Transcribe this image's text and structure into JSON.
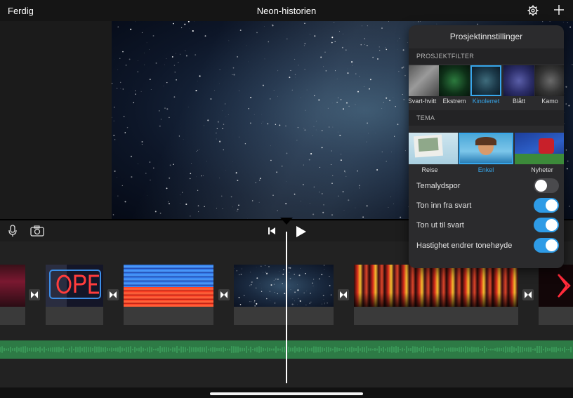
{
  "topbar": {
    "done_label": "Ferdig",
    "title": "Neon-historien",
    "icons": [
      "gear-icon",
      "plus-icon"
    ]
  },
  "controls": {
    "icons": [
      "microphone-icon",
      "camera-icon",
      "skip-to-start-icon",
      "play-icon"
    ]
  },
  "popover": {
    "title": "Prosjektinnstillinger",
    "filter_header": "PROSJEKTFILTER",
    "filters": [
      {
        "label": "Svart-hvitt",
        "selected": false
      },
      {
        "label": "Ekstrem",
        "selected": false
      },
      {
        "label": "Kinolerret",
        "selected": true
      },
      {
        "label": "Blått",
        "selected": false
      },
      {
        "label": "Kamo",
        "selected": false
      }
    ],
    "theme_header": "TEMA",
    "themes": [
      {
        "label": "Reise",
        "selected": false
      },
      {
        "label": "Enkel",
        "selected": true
      },
      {
        "label": "Nyheter",
        "selected": false
      }
    ],
    "settings": [
      {
        "label": "Temalydspor",
        "on": false
      },
      {
        "label": "Ton inn fra svart",
        "on": true
      },
      {
        "label": "Ton ut til svart",
        "on": true
      },
      {
        "label": "Hastighet endrer tonehøyde",
        "on": true
      }
    ]
  },
  "colors": {
    "accent": "#37a7ec",
    "toggle_on": "#2e9be6",
    "audio_track": "#2d7a45"
  }
}
